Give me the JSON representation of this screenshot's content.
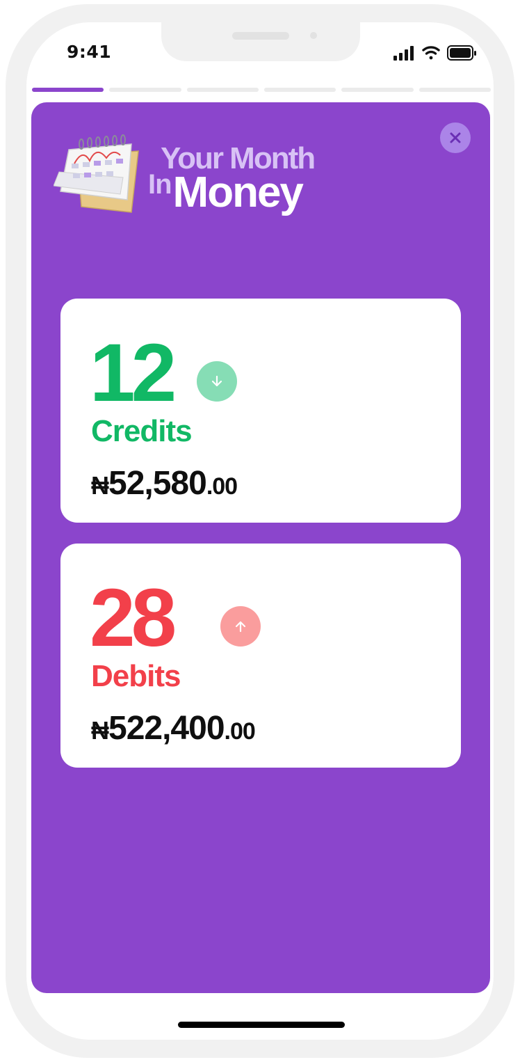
{
  "status_bar": {
    "time": "9:41"
  },
  "stories": {
    "total": 6,
    "active_index": 0
  },
  "header": {
    "line1": "Your Month",
    "line2_small": "In",
    "line2_large": "Money"
  },
  "credits": {
    "count": "12",
    "label": "Credits",
    "currency": "₦",
    "amount_whole": "52,580",
    "amount_decimal": ".00",
    "color": "#11b865",
    "arrow_bg": "#86ddb5",
    "arrow_icon": "arrow-down-icon"
  },
  "debits": {
    "count": "28",
    "label": "Debits",
    "currency": "₦",
    "amount_whole": "522,400",
    "amount_decimal": ".00",
    "color": "#f2404a",
    "arrow_bg": "#fa9d9d",
    "arrow_icon": "arrow-up-icon"
  },
  "colors": {
    "accent": "#8b45cc",
    "close_bg": "#ab84e8"
  }
}
